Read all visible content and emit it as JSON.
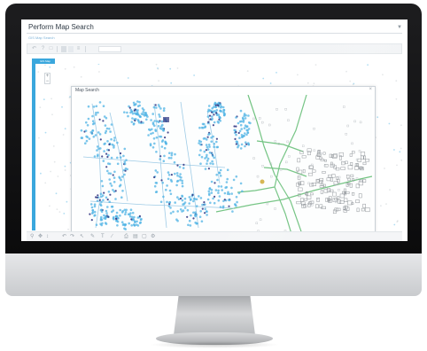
{
  "app": {
    "title": "Perform Map Search",
    "breadcrumb": "GIS Map Search"
  },
  "toolbar": {
    "icons": [
      "undo-icon",
      "help-icon",
      "select-icon",
      "layer-icon",
      "grid-icon",
      "list-icon"
    ]
  },
  "map": {
    "tab_label": "GIS Map Search",
    "zoom_in": "+",
    "zoom_out": "−"
  },
  "panel": {
    "title": "Map Search",
    "close": "×"
  },
  "bottom_toolbar": {
    "icons": [
      "zoom-icon",
      "pan-icon",
      "measure-icon",
      "undo-icon",
      "redo-icon",
      "pointer-icon",
      "draw-icon",
      "text-icon",
      "edit-icon",
      "print-icon",
      "layers-icon",
      "export-icon",
      "settings-icon"
    ]
  },
  "colors": {
    "accent": "#3aa7dd",
    "asset_points": "#4fb3e4",
    "asset_dark": "#2b2f7e",
    "parcel_green": "#6fc27f",
    "buildings": "#8f9499",
    "monitor_frame": "#111113"
  }
}
